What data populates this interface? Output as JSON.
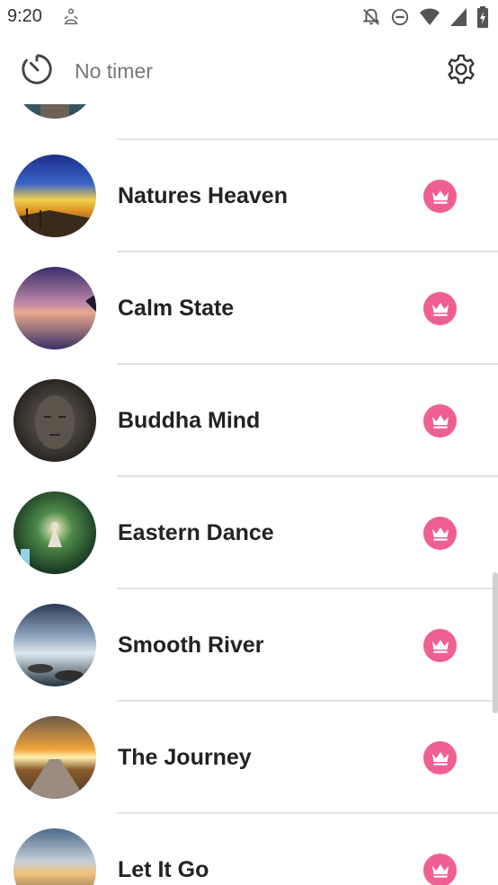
{
  "status_bar": {
    "time": "9:20",
    "left_icon": "meditation-notification-icon",
    "right_icons": [
      "notifications-off-icon",
      "do-not-disturb-icon",
      "wifi-icon",
      "cell-signal-icon",
      "battery-icon"
    ]
  },
  "header": {
    "timer_icon": "timer-icon",
    "timer_label": "No timer",
    "settings_icon": "gear-icon"
  },
  "colors": {
    "premium_badge": "#ef5f94",
    "divider": "#e2e2e2"
  },
  "tracks": [
    {
      "title": "Natures Heaven",
      "badge": "crown-icon"
    },
    {
      "title": "Calm State",
      "badge": "crown-icon"
    },
    {
      "title": "Buddha Mind",
      "badge": "crown-icon"
    },
    {
      "title": "Eastern Dance",
      "badge": "crown-icon"
    },
    {
      "title": "Smooth River",
      "badge": "crown-icon"
    },
    {
      "title": "The Journey",
      "badge": "crown-icon"
    },
    {
      "title": "Let It Go",
      "badge": "crown-icon"
    }
  ]
}
